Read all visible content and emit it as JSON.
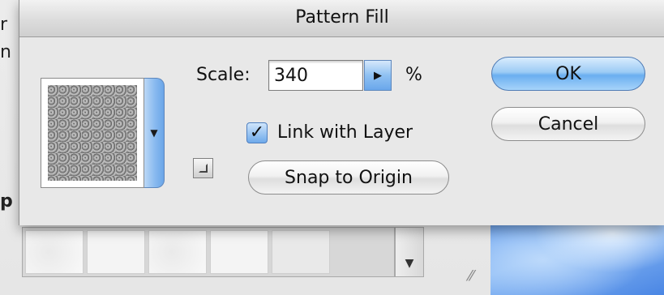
{
  "dialog": {
    "title": "Pattern Fill",
    "scale": {
      "label": "Scale:",
      "value": "340",
      "unit": "%"
    },
    "link_with_layer": {
      "label": "Link with Layer",
      "checked": true,
      "check_glyph": "✓"
    },
    "snap_button_label": "Snap to Origin",
    "ok_label": "OK",
    "cancel_label": "Cancel",
    "pattern_dropdown_glyph": "▼",
    "stepper_glyph": "▶"
  },
  "background": {
    "edge_texts": [
      "r",
      "n",
      "p"
    ],
    "strip_scroll_glyph": "▼",
    "resize_glyph": "⁄⁄"
  },
  "colors": {
    "accent_blue": "#6aaef0",
    "dialog_bg": "#e8e8e8"
  },
  "icons": {
    "pattern_dropdown": "chevron-down-icon",
    "stepper": "triangle-right-icon",
    "origin": "new-preset-icon",
    "checkbox": "checkmark-icon"
  }
}
